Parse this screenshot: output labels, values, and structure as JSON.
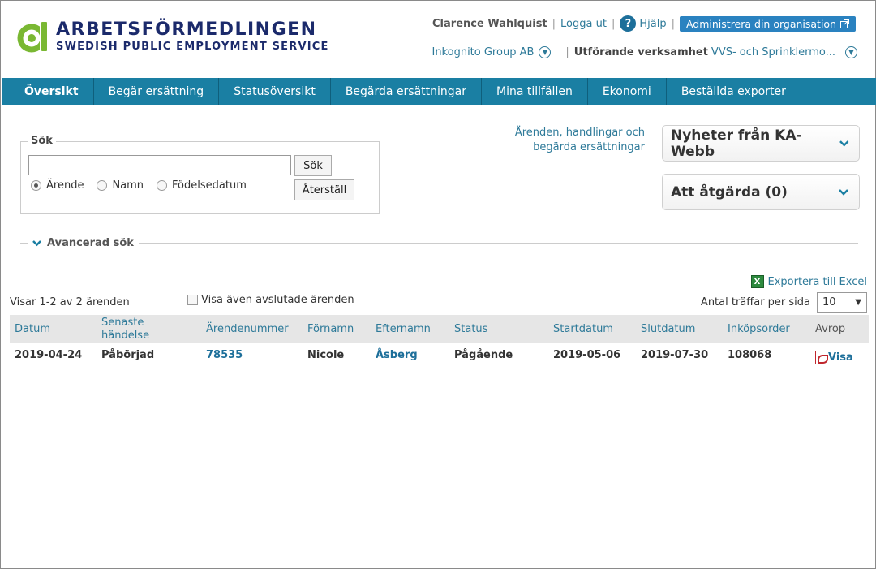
{
  "header": {
    "logo_title": "ARBETSFÖRMEDLINGEN",
    "logo_subtitle": "SWEDISH PUBLIC EMPLOYMENT SERVICE",
    "user_name": "Clarence Wahlquist",
    "logout": "Logga ut",
    "help": "Hjälp",
    "admin_button": "Administrera din organisation",
    "org_name": "Inkognito Group AB",
    "executing_label": "Utförande verksamhet",
    "executing_value": "VVS- och Sprinklermo..."
  },
  "nav": {
    "items": [
      {
        "label": "Översikt"
      },
      {
        "label": "Begär ersättning"
      },
      {
        "label": "Statusöversikt"
      },
      {
        "label": "Begärda ersättningar"
      },
      {
        "label": "Mina tillfällen"
      },
      {
        "label": "Ekonomi"
      },
      {
        "label": "Beställda exporter"
      }
    ]
  },
  "search": {
    "legend": "Sök",
    "input_value": "",
    "search_button": "Sök",
    "reset_button": "Återställ",
    "radios": [
      {
        "label": "Ärende",
        "checked": true
      },
      {
        "label": "Namn",
        "checked": false
      },
      {
        "label": "Födelsedatum",
        "checked": false
      }
    ]
  },
  "side_link": "Ärenden, handlingar och begärda ersättningar",
  "panels": [
    {
      "title": "Nyheter från KA-Webb"
    },
    {
      "title": "Att åtgärda (0)"
    }
  ],
  "advanced_search": "Avancerad sök",
  "export_label": "Exportera till Excel",
  "showing_text": "Visar 1-2 av 2 ärenden",
  "show_closed": "Visa även avslutade ärenden",
  "per_page_label": "Antal träffar per sida",
  "per_page_value": "10",
  "table": {
    "headers": {
      "datum": "Datum",
      "senaste": "Senaste händelse",
      "arendenummer": "Ärendenummer",
      "fornamn": "Förnamn",
      "efternamn": "Efternamn",
      "status": "Status",
      "startdatum": "Startdatum",
      "slutdatum": "Slutdatum",
      "inkopsorder": "Inköpsorder",
      "avrop": "Avrop"
    },
    "rows": [
      {
        "datum": "2019-04-24",
        "senaste": "Påbörjad",
        "arendenummer": "78535",
        "fornamn": "Nicole",
        "efternamn": "Åsberg",
        "status": "Pågående",
        "startdatum": "2019-05-06",
        "slutdatum": "2019-07-30",
        "inkopsorder": "108068",
        "avrop": "Visa"
      }
    ]
  },
  "colors": {
    "nav_bg": "#1a7fa3",
    "logo_green": "#7ab833",
    "logo_navy": "#1b2a6b",
    "link": "#2e7a99",
    "admin_button": "#2a82c0"
  }
}
